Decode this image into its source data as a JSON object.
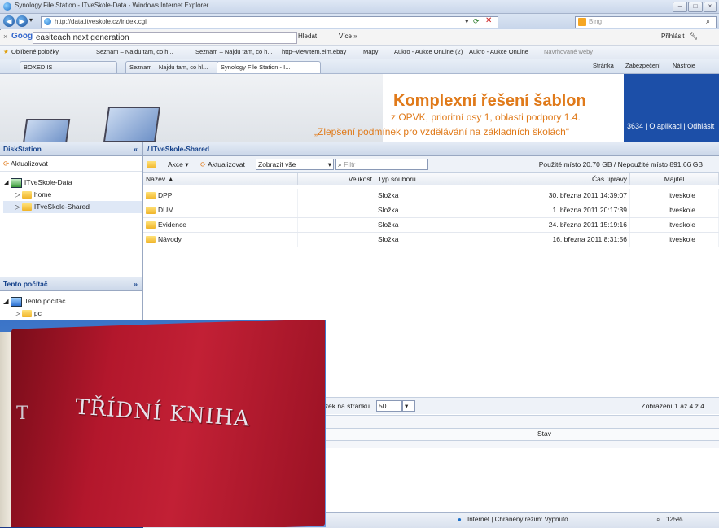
{
  "window": {
    "title": "Synology File Station - ITveSkole-Data - Windows Internet Explorer",
    "address": "http://data.itveskole.cz/index.cgi",
    "bing_placeholder": "Bing"
  },
  "google_toolbar": {
    "logo": "Google",
    "search_value": "easiteach next generation",
    "hledat": "Hledat",
    "vice": "Více »",
    "prihlasit": "Přihlásit"
  },
  "favorites": {
    "label": "Oblíbené položky",
    "items": [
      "Seznam – Najdu tam, co h...",
      "Seznam – Najdu tam, co h...",
      "http--viewitem.eim.ebay",
      "Mapy",
      "Aukro - Aukce OnLine (2)",
      "Aukro - Aukce OnLine",
      "Navrhované weby"
    ]
  },
  "tabs": {
    "group": "BOXED IS",
    "items": [
      "Seznam – Najdu tam, co hl...",
      "Synology File Station - I..."
    ],
    "right_tools": [
      "Stránka",
      "Zabezpečení",
      "Nástroje"
    ]
  },
  "banner": {
    "title": "Komplexní řešení šablon",
    "sub1": "z OPVK, prioritní osy 1, oblasti podpory 1.4.",
    "sub2": "„Zlepšení podmínek pro vzdělávání na základních školách“",
    "userlinks": "3634 | O aplikaci | Odhlásit"
  },
  "left": {
    "header": "DiskStation",
    "refresh": "Aktualizovat",
    "tree": {
      "root": "ITveSkole-Data",
      "children": [
        "home",
        "ITveSkole-Shared"
      ]
    },
    "computer_header": "Tento počítač",
    "computer_tree": {
      "root": "Tento počítač",
      "children": [
        "pc"
      ]
    }
  },
  "right": {
    "breadcrumb": "/ ITveSkole-Shared",
    "toolbar": {
      "akce": "Akce",
      "refresh": "Aktualizovat",
      "view_select": "Zobrazit vše",
      "filter_placeholder": "Filtr",
      "usage": "Použité místo 20.70 GB / Nepoužité místo 891.66 GB"
    },
    "columns": [
      "Název ▲",
      "Velikost",
      "Typ souboru",
      "Čas úpravy",
      "Majitel"
    ],
    "rows": [
      {
        "name": "DPP",
        "size": "",
        "type": "Složka",
        "time": "30. března 2011 14:39:07",
        "owner": "itveskole"
      },
      {
        "name": "DUM",
        "size": "",
        "type": "Složka",
        "time": "1. března 2011 20:17:39",
        "owner": "itveskole"
      },
      {
        "name": "Evidence",
        "size": "",
        "type": "Složka",
        "time": "24. března 2011 15:19:16",
        "owner": "itveskole"
      },
      {
        "name": "Návody",
        "size": "",
        "type": "Složka",
        "time": "16. března 2011 8:31:56",
        "owner": "itveskole"
      }
    ],
    "pager": {
      "per_page_label": "ožek na stránku",
      "per_page_value": "50",
      "summary": "Zobrazení 1 až 4 z 4"
    },
    "lower_col": "Stav"
  },
  "statusbar": {
    "zone": "Internet | Chráněný režim: Vypnuto",
    "zoom": "125%"
  },
  "book": {
    "title": "TŘÍDNÍ KNIHA",
    "partial": "T"
  }
}
